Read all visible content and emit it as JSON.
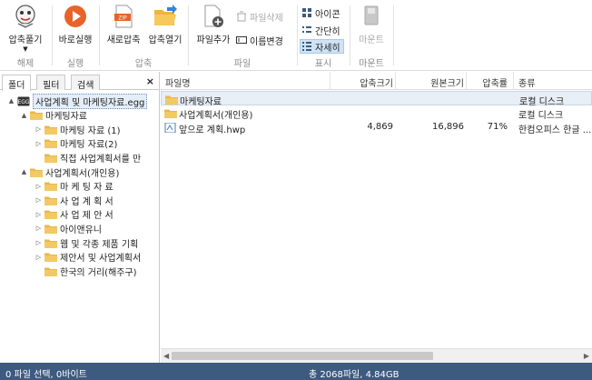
{
  "ribbon": {
    "compress_more": "압축풀기",
    "group_extract": "해제",
    "run": "바로실행",
    "group_run": "실행",
    "new_archive": "새로압축",
    "open_archive": "압축열기",
    "group_archive": "압축",
    "add_file": "파일추가",
    "delete_file": "파일삭제",
    "rename": "이름변경",
    "group_file": "파일",
    "view_icons": "아이콘",
    "view_list": "간단히",
    "view_details": "자세히",
    "group_view": "표시",
    "mount": "마운트",
    "group_mount": "마운트"
  },
  "left_tabs": [
    "폴더",
    "필터",
    "검색"
  ],
  "close_symbol": "×",
  "tree": [
    {
      "label": "사업계획 및 마케팅자료.egg",
      "level": 0,
      "type": "egg",
      "toggle": "▲",
      "selected": true
    },
    {
      "label": "마케팅자료",
      "level": 1,
      "type": "folder",
      "toggle": "▲"
    },
    {
      "label": "마케팅 자료 (1)",
      "level": 2,
      "type": "folder",
      "toggle": "▷"
    },
    {
      "label": "마케팅 자료(2)",
      "level": 2,
      "type": "folder",
      "toggle": "▷"
    },
    {
      "label": "직접 사업계획서를 만",
      "level": 2,
      "type": "folder",
      "toggle": ""
    },
    {
      "label": "사업계획서(개인용)",
      "level": 1,
      "type": "folder",
      "toggle": "▲"
    },
    {
      "label": "마 케 팅 자 료",
      "level": 2,
      "type": "folder",
      "toggle": "▷"
    },
    {
      "label": "사 업 계 획 서",
      "level": 2,
      "type": "folder",
      "toggle": "▷"
    },
    {
      "label": "사 업 제 안 서",
      "level": 2,
      "type": "folder",
      "toggle": "▷"
    },
    {
      "label": "아이앤유니",
      "level": 2,
      "type": "folder",
      "toggle": "▷"
    },
    {
      "label": "웹 및 각종 제품 기획",
      "level": 2,
      "type": "folder",
      "toggle": "▷"
    },
    {
      "label": "제안서 및 사업계획서",
      "level": 2,
      "type": "folder",
      "toggle": "▷"
    },
    {
      "label": "한국의 거리(해주구)",
      "level": 2,
      "type": "folder",
      "toggle": ""
    }
  ],
  "columns": [
    "파일명",
    "압축크기",
    "원본크기",
    "압축률",
    "종류"
  ],
  "files": [
    {
      "name": "마케팅자료",
      "packed": "",
      "original": "",
      "ratio": "",
      "kind": "로컬 디스크",
      "type": "folder",
      "selected": true
    },
    {
      "name": "사업계획서(개인용)",
      "packed": "",
      "original": "",
      "ratio": "",
      "kind": "로컬 디스크",
      "type": "folder"
    },
    {
      "name": "앞으로 계획.hwp",
      "packed": "4,869",
      "original": "16,896",
      "ratio": "71%",
      "kind": "한컴오피스 한글 ...",
      "type": "hwp"
    }
  ],
  "status": {
    "left": "0 파일 선택,  0바이트",
    "right": "총 2068파일,  4.84GB"
  },
  "colors": {
    "accent": "#3d5a80",
    "folder": "#e8b84a",
    "orange": "#e8632b"
  }
}
